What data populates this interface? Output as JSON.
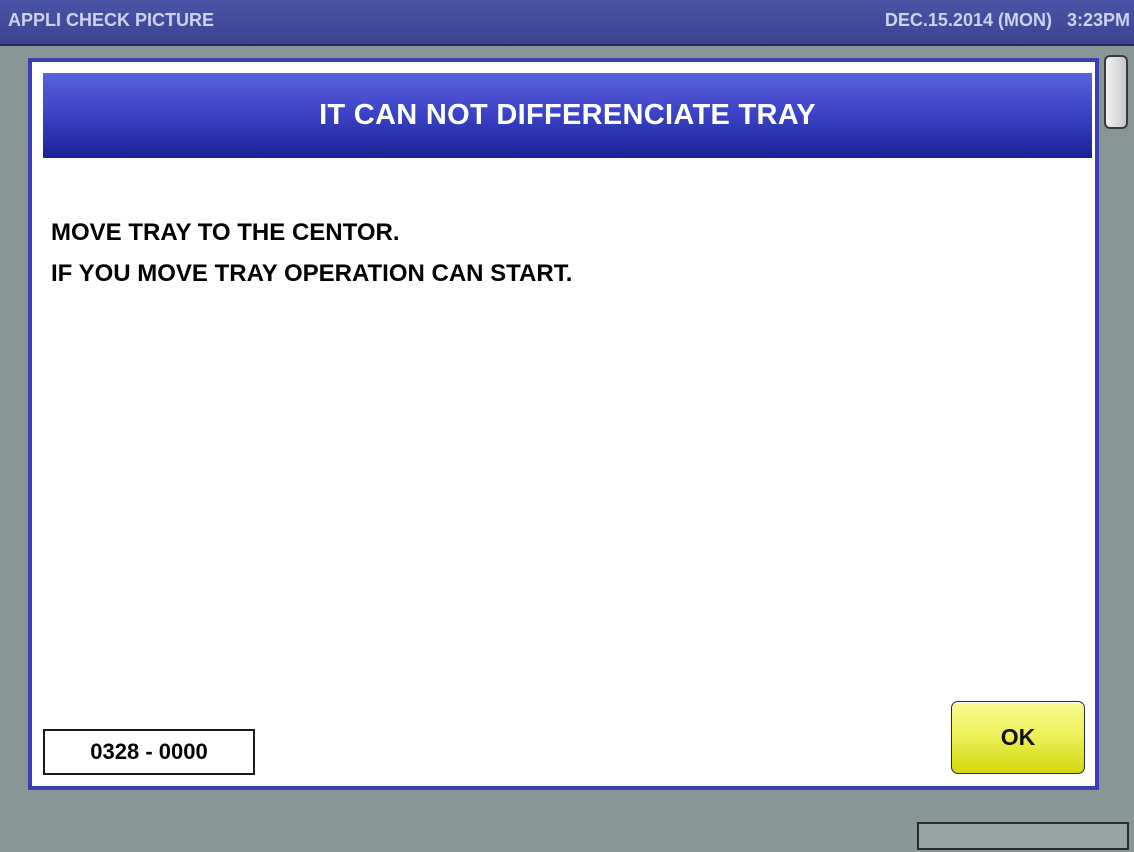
{
  "header": {
    "app_title": "APPLI CHECK PICTURE",
    "datetime": "DEC.15.2014 (MON)   3:23PM"
  },
  "dialog": {
    "title": "IT CAN NOT DIFFERENCIATE TRAY",
    "message_lines": [
      "MOVE TRAY TO THE CENTOR.",
      "IF YOU MOVE TRAY OPERATION CAN START."
    ],
    "error_code": "0328 - 0000",
    "ok_label": "OK"
  },
  "colors": {
    "topbar": "#3f489a",
    "dialog_border": "#3a3fb4",
    "ok_button": "#eef05a",
    "background": "#889796"
  }
}
